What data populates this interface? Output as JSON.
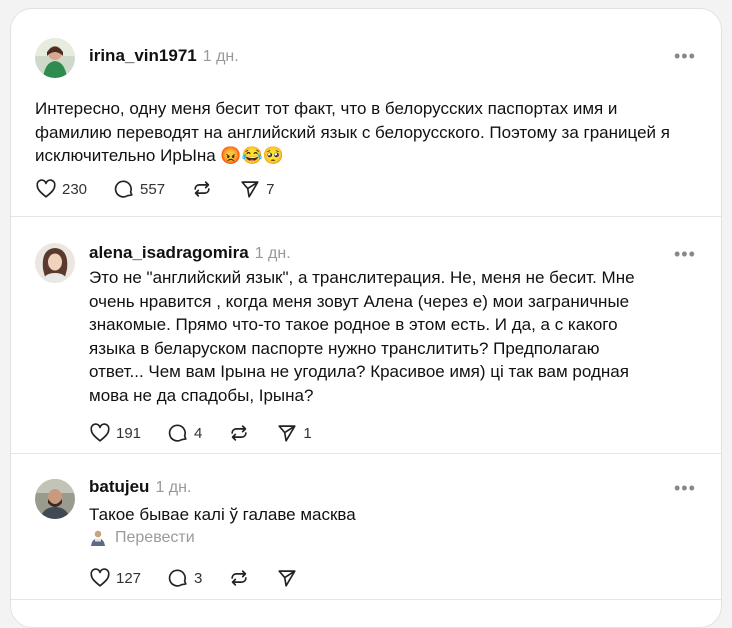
{
  "posts": [
    {
      "username": "irina_vin1971",
      "time": "1 дн.",
      "more": "•••",
      "text": "Интересно, одну меня бесит тот факт, что в белорусских паспортах имя и фамилию переводят на английский язык с белорусского. Поэтому за границей я исключительно ИрЫна 😡😂🥺",
      "likes": "230",
      "comments": "557",
      "reposts": "",
      "shares": "7"
    },
    {
      "username": "alena_isadragomira",
      "time": "1 дн.",
      "more": "•••",
      "text": "Это не \"английский язык\", а транслитерация. Не, меня не бесит. Мне очень нравится , когда меня зовут Алена (через е) мои заграничные знакомые. Прямо что-то такое родное в этом есть. И да, а с какого языка в беларуском паспорте нужно транслитить? Предполагаю ответ... Чем вам Ірына не угодила? Красивое имя) ці так вам родная мова не да спадобы, Ірына?",
      "likes": "191",
      "comments": "4",
      "reposts": "",
      "shares": "1"
    },
    {
      "username": "batujeu",
      "time": "1 дн.",
      "more": "•••",
      "text": "Такое бывае калі ў галаве масква",
      "translate": "Перевести",
      "likes": "127",
      "comments": "3",
      "reposts": "",
      "shares": ""
    }
  ],
  "icons": {
    "like": "heart-icon",
    "comment": "comment-bubble-icon",
    "repost": "repost-icon",
    "share": "send-icon",
    "translate": "translate-icon",
    "more": "more-icon"
  }
}
